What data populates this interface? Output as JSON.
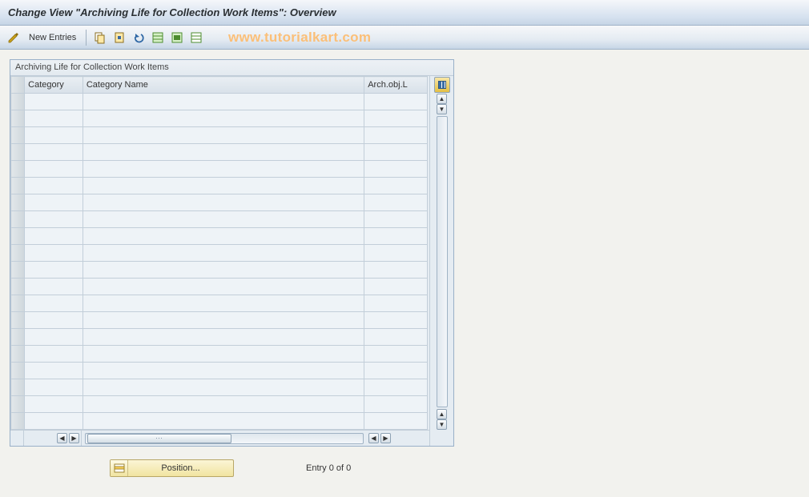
{
  "header": {
    "title": "Change View \"Archiving Life for Collection Work Items\": Overview"
  },
  "toolbar": {
    "new_entries_label": "New Entries",
    "icons": {
      "display_change": "display-change-icon",
      "copy": "copy-icon",
      "delete": "delete-icon",
      "undo": "undo-icon",
      "select_all": "select-all-icon",
      "select_block": "select-block-icon",
      "deselect_all": "deselect-all-icon"
    }
  },
  "watermark": "www.tutorialkart.com",
  "groupbox": {
    "title": "Archiving Life for Collection Work Items"
  },
  "table": {
    "columns": {
      "category": "Category",
      "category_name": "Category Name",
      "arch_obj_l": "Arch.obj.L"
    },
    "rows": [
      {
        "category": "",
        "category_name": "",
        "arch_obj_l": ""
      },
      {
        "category": "",
        "category_name": "",
        "arch_obj_l": ""
      },
      {
        "category": "",
        "category_name": "",
        "arch_obj_l": ""
      },
      {
        "category": "",
        "category_name": "",
        "arch_obj_l": ""
      },
      {
        "category": "",
        "category_name": "",
        "arch_obj_l": ""
      },
      {
        "category": "",
        "category_name": "",
        "arch_obj_l": ""
      },
      {
        "category": "",
        "category_name": "",
        "arch_obj_l": ""
      },
      {
        "category": "",
        "category_name": "",
        "arch_obj_l": ""
      },
      {
        "category": "",
        "category_name": "",
        "arch_obj_l": ""
      },
      {
        "category": "",
        "category_name": "",
        "arch_obj_l": ""
      },
      {
        "category": "",
        "category_name": "",
        "arch_obj_l": ""
      },
      {
        "category": "",
        "category_name": "",
        "arch_obj_l": ""
      },
      {
        "category": "",
        "category_name": "",
        "arch_obj_l": ""
      },
      {
        "category": "",
        "category_name": "",
        "arch_obj_l": ""
      },
      {
        "category": "",
        "category_name": "",
        "arch_obj_l": ""
      },
      {
        "category": "",
        "category_name": "",
        "arch_obj_l": ""
      },
      {
        "category": "",
        "category_name": "",
        "arch_obj_l": ""
      },
      {
        "category": "",
        "category_name": "",
        "arch_obj_l": ""
      },
      {
        "category": "",
        "category_name": "",
        "arch_obj_l": ""
      },
      {
        "category": "",
        "category_name": "",
        "arch_obj_l": ""
      }
    ]
  },
  "footer": {
    "position_label": "Position...",
    "entry_status": "Entry 0 of 0"
  }
}
